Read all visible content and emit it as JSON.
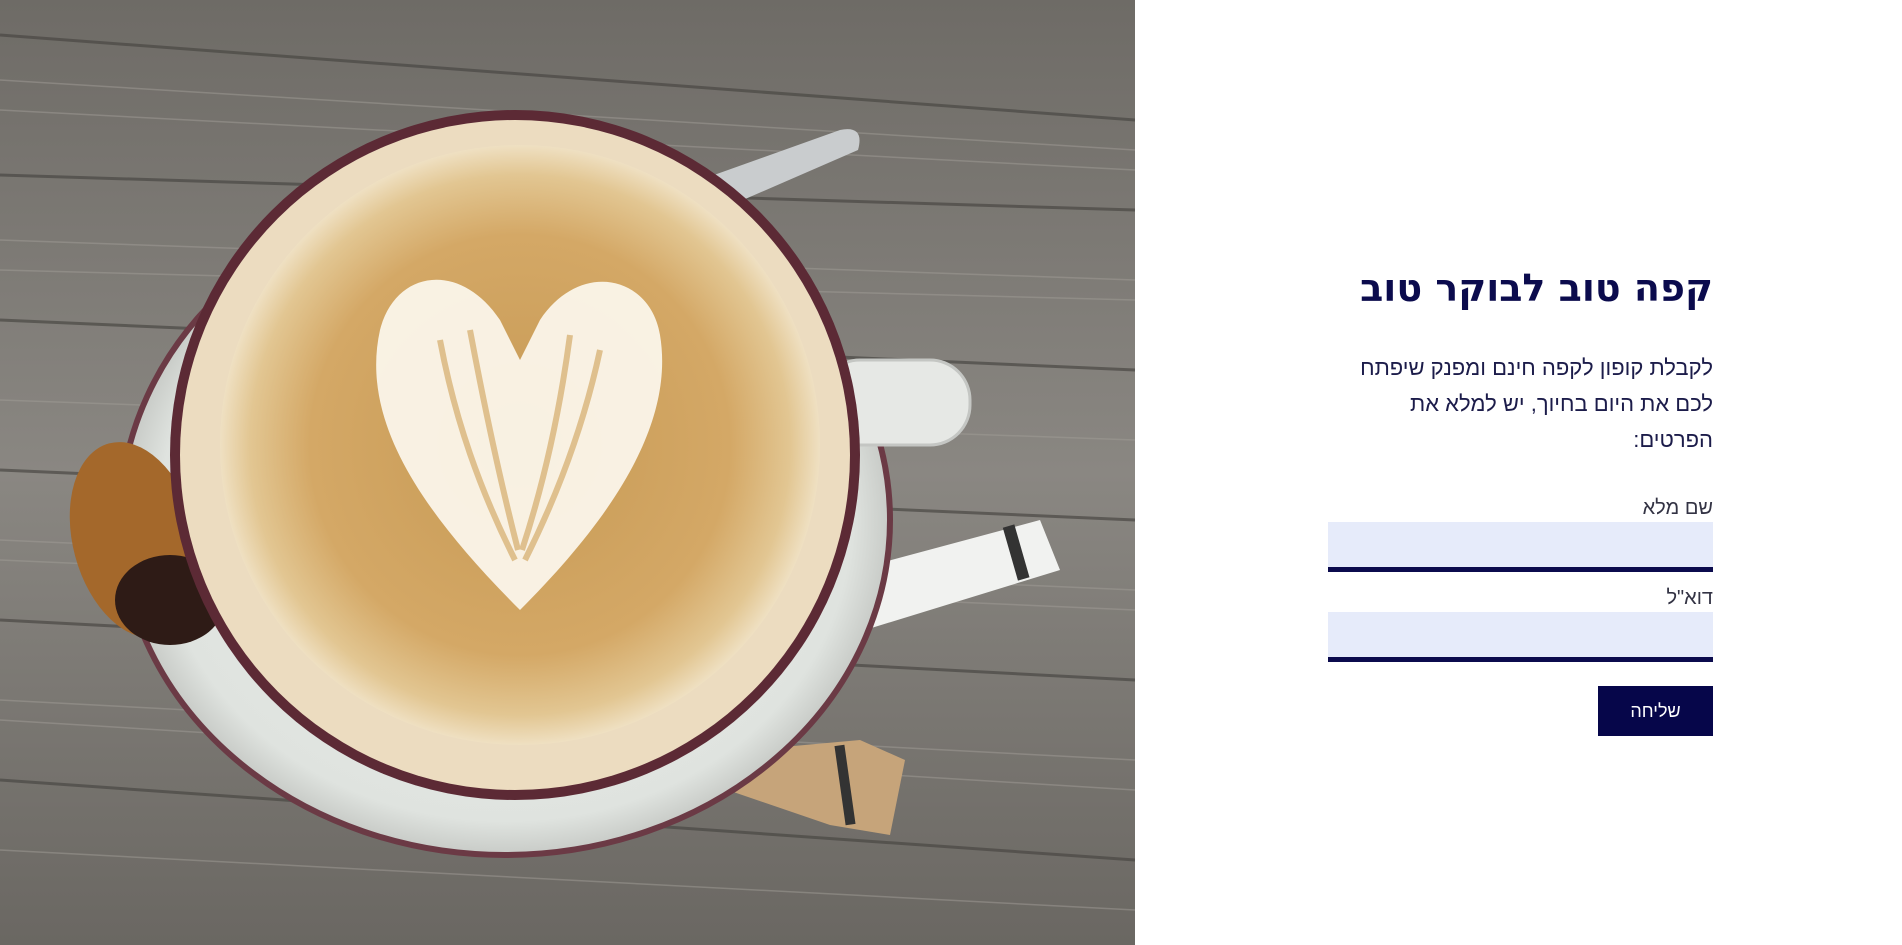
{
  "hero": {
    "image": "latte-art-coffee-cup-photo"
  },
  "form": {
    "title": "קפה טוב לבוקר טוב",
    "intro_line1": "לקבלת קופון לקפה חינם ומפנק שיפתח",
    "intro_line2": "לכם את היום בחיוך, יש למלא את הפרטים:",
    "name_label": "שם מלא",
    "name_value": "",
    "email_label": "דוא\"ל",
    "email_value": "",
    "submit_label": "שליחה"
  },
  "colors": {
    "title": "#0b0b4d",
    "input_bg": "#e6ebfa",
    "input_border": "#0b0b4d",
    "button_bg": "#06064a",
    "button_text": "#ffffff"
  }
}
